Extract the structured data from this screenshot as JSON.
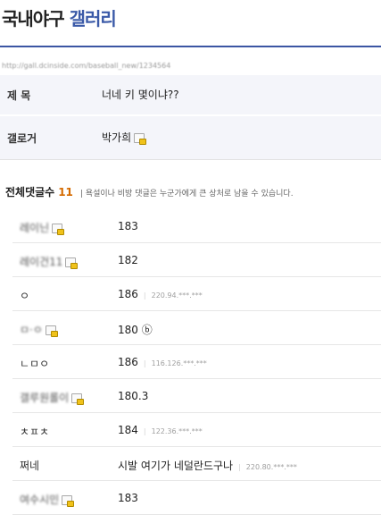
{
  "header": {
    "title_main": "국내야구",
    "title_accent": "갤러리",
    "accent_color": "#3b5aa8"
  },
  "url_text": "http://gall.dcinside.com/baseball_new/1234564",
  "post": {
    "subject_label": "제 목",
    "subject_value": "너네 키 몇이냐??",
    "author_label": "갤로거",
    "author_value": "박가희"
  },
  "comments_header": {
    "label": "전체댓글수",
    "count": "11",
    "note": "| 욕설이나 비방 댓글은 누군가에게 큰 상처로 남을 수 있습니다."
  },
  "comments": [
    {
      "name": "레이닌",
      "blurred": true,
      "gallog": true,
      "text": "183",
      "ip": ""
    },
    {
      "name": "레이건11",
      "blurred": true,
      "gallog": true,
      "text": "182",
      "ip": ""
    },
    {
      "name": "ㅇ",
      "blurred": false,
      "gallog": false,
      "text": "186",
      "ip": "220.94.***.***"
    },
    {
      "name": "ㅁ·ㅇ",
      "blurred": true,
      "gallog": true,
      "text": "180 ⓑ",
      "ip": ""
    },
    {
      "name": "ㄴㅁㅇ",
      "blurred": false,
      "gallog": false,
      "text": "186",
      "ip": "116.126.***.***"
    },
    {
      "name": "갤루원롤이",
      "blurred": true,
      "gallog": true,
      "text": "180.3",
      "ip": ""
    },
    {
      "name": "ㅊㅍㅊ",
      "blurred": false,
      "gallog": false,
      "text": "184",
      "ip": "122.36.***.***"
    },
    {
      "name": "쩌네",
      "blurred": false,
      "gallog": false,
      "text": "시발 여기가 네덜란드구나",
      "ip": "220.80.***.***"
    },
    {
      "name": "여수시민",
      "blurred": true,
      "gallog": true,
      "text": "183",
      "ip": ""
    }
  ]
}
